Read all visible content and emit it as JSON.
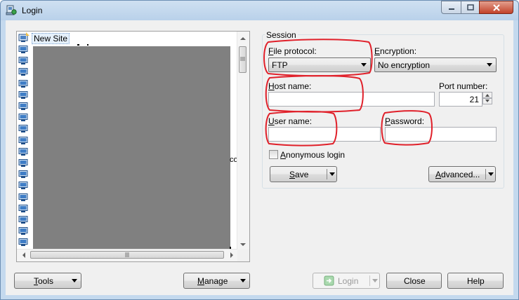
{
  "window": {
    "title": "Login"
  },
  "tree": {
    "new_site_label": "New Site",
    "visible_fragment": "con"
  },
  "session": {
    "group_title": "Session",
    "file_protocol": {
      "accel": "F",
      "rest": "ile protocol:",
      "value": "FTP"
    },
    "encryption": {
      "accel": "E",
      "rest": "ncryption:",
      "value": "No encryption"
    },
    "host_name": {
      "accel": "H",
      "rest": "ost name:",
      "value": ""
    },
    "port_number": {
      "label": "Port number:",
      "value": "21"
    },
    "user_name": {
      "accel": "U",
      "rest": "ser name:",
      "value": ""
    },
    "password": {
      "accel": "P",
      "rest": "assword:",
      "value": ""
    },
    "anonymous_login": {
      "accel": "A",
      "rest": "nonymous login",
      "checked": false
    },
    "save": {
      "accel": "S",
      "rest": "ave"
    },
    "advanced": {
      "accel": "A",
      "rest": "dvanced..."
    }
  },
  "footer": {
    "tools": {
      "accel": "T",
      "rest": "ools"
    },
    "manage": {
      "accel": "M",
      "rest": "anage"
    },
    "login": {
      "label": "Login",
      "enabled": false
    },
    "close": {
      "label": "Close"
    },
    "help": {
      "label": "Help"
    }
  },
  "annotation_color": "#e0202a"
}
